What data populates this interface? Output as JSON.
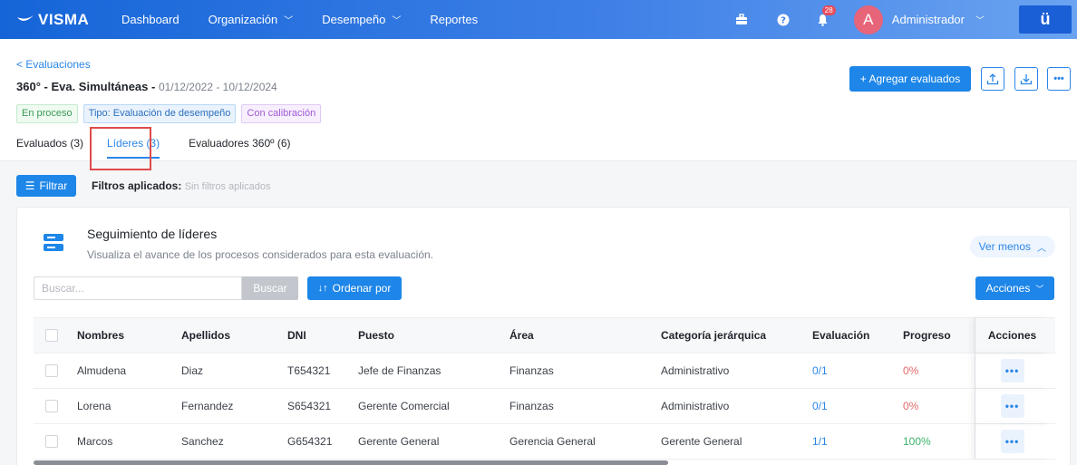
{
  "nav": {
    "logo": "VISMA",
    "items": [
      {
        "label": "Dashboard",
        "has_chevron": false
      },
      {
        "label": "Organización",
        "has_chevron": true
      },
      {
        "label": "Desempeño",
        "has_chevron": true
      },
      {
        "label": "Reportes",
        "has_chevron": false
      }
    ],
    "notifications_count": "28",
    "avatar_initial": "A",
    "user_name": "Administrador",
    "app_switch_label": "ü"
  },
  "header": {
    "back_link": "< Evaluaciones",
    "title": "360° - Eva. Simultáneas - ",
    "dates": "01/12/2022 - 10/12/2024",
    "tags": [
      "En proceso",
      "Tipo: Evaluación de desempeño",
      "Con calibración"
    ],
    "tabs": [
      "Evaluados (3)",
      "Líderes (3)",
      "Evaluadores 360º (6)"
    ],
    "add_button": "+ Agregar evaluados"
  },
  "filters": {
    "button": "Filtrar",
    "label": "Filtros aplicados:",
    "value": "Sin filtros aplicados"
  },
  "card": {
    "title": "Seguimiento de líderes",
    "subtitle": "Visualiza el avance de los procesos considerados para esta evaluación.",
    "toggle": "Ver menos",
    "search_placeholder": "Buscar...",
    "search_button": "Buscar",
    "order_button": "Ordenar por",
    "actions_button": "Acciones"
  },
  "table": {
    "columns": [
      "Nombres",
      "Apellidos",
      "DNI",
      "Puesto",
      "Área",
      "Categoría jerárquica",
      "Evaluación",
      "Progreso",
      "Acciones"
    ],
    "rows": [
      {
        "nombres": "Almudena",
        "apellidos": "Diaz",
        "dni": "T654321",
        "puesto": "Jefe de Finanzas",
        "area": "Finanzas",
        "categoria": "Administrativo",
        "evaluacion": "0/1",
        "progreso": "0%"
      },
      {
        "nombres": "Lorena",
        "apellidos": "Fernandez",
        "dni": "S654321",
        "puesto": "Gerente Comercial",
        "area": "Finanzas",
        "categoria": "Administrativo",
        "evaluacion": "0/1",
        "progreso": "0%"
      },
      {
        "nombres": "Marcos",
        "apellidos": "Sanchez",
        "dni": "G654321",
        "puesto": "Gerente General",
        "area": "Gerencia General",
        "categoria": "Gerente General",
        "evaluacion": "1/1",
        "progreso": "100%"
      }
    ]
  },
  "colors": {
    "nav_start": "#1565d8",
    "nav_end": "#6aa3f0",
    "accent": "#1d86e8",
    "progress_zero": "#e6696b",
    "progress_done": "#3bb46a",
    "highlight_outline": "#e04a4a"
  }
}
